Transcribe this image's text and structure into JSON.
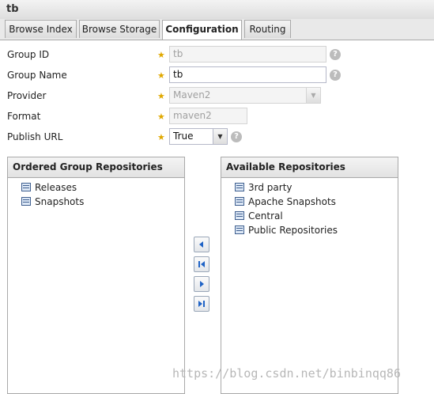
{
  "window": {
    "title": "tb"
  },
  "tabs": [
    {
      "label": "Browse Index"
    },
    {
      "label": "Browse Storage"
    },
    {
      "label": "Configuration",
      "active": true
    },
    {
      "label": "Routing"
    }
  ],
  "form": {
    "group_id": {
      "label": "Group ID",
      "value": "tb",
      "required": "★",
      "disabled": true
    },
    "group_name": {
      "label": "Group Name",
      "value": "tb",
      "required": "★"
    },
    "provider": {
      "label": "Provider",
      "value": "Maven2",
      "required": "★",
      "disabled": true
    },
    "format": {
      "label": "Format",
      "value": "maven2",
      "required": "★",
      "disabled": true
    },
    "publish_url": {
      "label": "Publish URL",
      "value": "True",
      "required": "★"
    },
    "help_glyph": "?"
  },
  "ordered_group": {
    "title": "Ordered Group Repositories",
    "items": [
      "Releases",
      "Snapshots"
    ]
  },
  "available": {
    "title": "Available Repositories",
    "items": [
      "3rd party",
      "Apache Snapshots",
      "Central",
      "Public Repositories"
    ]
  },
  "move_buttons": [
    {
      "icon": "arrow-left-icon"
    },
    {
      "icon": "arrow-first-icon"
    },
    {
      "icon": "arrow-right-icon"
    },
    {
      "icon": "arrow-last-icon"
    }
  ],
  "watermark": "https://blog.csdn.net/binbinqq86",
  "colors": {
    "required_star": "#e0a800",
    "icon_blue": "#1f63c6",
    "border": "#a9a9a9"
  }
}
